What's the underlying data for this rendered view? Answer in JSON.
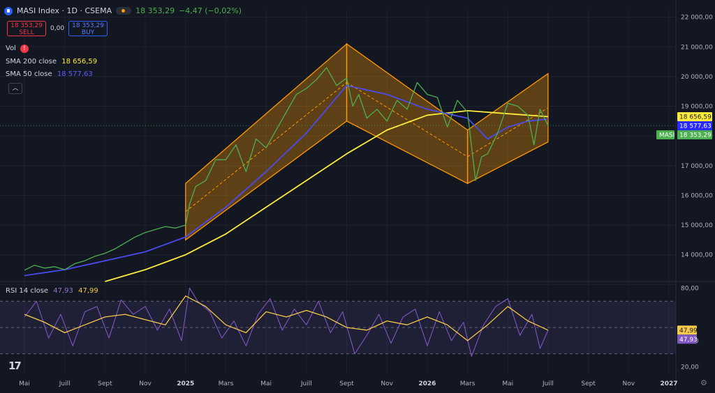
{
  "header": {
    "symbol": "MASI Index · 1D · CSEMA",
    "last": "18 353,29",
    "change": "−4,47 (−0,02%)"
  },
  "trade": {
    "sell_price": "18 353,29",
    "sell_label": "SELL",
    "spread": "0,00",
    "buy_price": "18 353,29",
    "buy_label": "BUY"
  },
  "indicators": {
    "vol": "Vol",
    "sma200_label": "SMA 200 close",
    "sma200_value": "18 656,59",
    "sma50_label": "SMA 50 close",
    "sma50_value": "18 577,63",
    "rsi_label": "RSI 14 close",
    "rsi_value": "47,93",
    "rsi_ma_value": "47,99"
  },
  "logo_text": "17",
  "colors": {
    "price": "#4caf50",
    "sma200": "#ffeb3b",
    "sma50": "#4a4aef",
    "channel": "#ff9800",
    "rsi": "#7e57c2",
    "rsi_ma": "#f7c948",
    "bg": "#131722"
  },
  "chart_data": [
    {
      "type": "line",
      "pane": "price",
      "y_ticks": [
        13000,
        14000,
        15000,
        16000,
        17000,
        18000,
        19000,
        20000,
        21000,
        22000
      ],
      "y_tick_labels": [
        "",
        "14 000,00",
        "15 000,00",
        "16 000,00",
        "17 000,00",
        "18 000,00",
        "19 000,00",
        "20 000,00",
        "21 000,00",
        "22 000,00"
      ],
      "ylim": [
        13100,
        22250
      ],
      "x_tick_labels": [
        "Mai",
        "Juill",
        "Sept",
        "Nov",
        "2025",
        "Mars",
        "Mai",
        "Juill",
        "Sept",
        "Nov",
        "2026",
        "Mars",
        "Mai",
        "Juill",
        "Sept",
        "Nov",
        "2027"
      ],
      "x_tick_index": [
        0,
        2,
        4,
        6,
        8,
        10,
        12,
        14,
        16,
        18,
        20,
        22,
        24,
        26,
        28,
        30,
        32
      ],
      "series": [
        {
          "name": "MASI",
          "x": [
            0,
            0.5,
            1,
            1.5,
            2,
            2.5,
            3,
            3.5,
            4,
            4.5,
            5,
            5.5,
            6,
            6.5,
            7,
            7.5,
            8,
            8.2,
            8.5,
            9,
            9.5,
            10,
            10.5,
            11,
            11.5,
            12,
            12.5,
            13,
            13.5,
            14,
            14.5,
            15,
            15.5,
            16,
            16.3,
            16.6,
            17,
            17.5,
            18,
            18.5,
            19,
            19.5,
            20,
            20.5,
            21,
            21.5,
            22,
            22.4,
            22.7,
            23,
            23.5,
            24,
            24.5,
            25,
            25.3,
            25.6,
            26
          ],
          "y": [
            13480,
            13650,
            13550,
            13600,
            13500,
            13700,
            13800,
            13950,
            14050,
            14200,
            14400,
            14600,
            14750,
            14850,
            14950,
            14900,
            15000,
            15700,
            16300,
            16500,
            17200,
            17200,
            17700,
            16800,
            17900,
            17600,
            18200,
            18800,
            19400,
            19600,
            19900,
            20300,
            19700,
            19950,
            19000,
            19400,
            18600,
            18900,
            18500,
            19200,
            18900,
            19800,
            19400,
            19300,
            18300,
            19200,
            18800,
            16500,
            17300,
            17400,
            18100,
            19100,
            19000,
            18700,
            17700,
            18900,
            18350
          ]
        },
        {
          "name": "SMA 200 close",
          "x": [
            4,
            6,
            8,
            10,
            12,
            14,
            16,
            18,
            20,
            22,
            24,
            26
          ],
          "y": [
            13100,
            13500,
            14000,
            14700,
            15600,
            16500,
            17400,
            18200,
            18700,
            18850,
            18750,
            18650
          ]
        },
        {
          "name": "SMA 50 close",
          "x": [
            0,
            2,
            4,
            6,
            8,
            10,
            12,
            14,
            16,
            18,
            20,
            22,
            23,
            24,
            25,
            26
          ],
          "y": [
            13300,
            13500,
            13800,
            14100,
            14600,
            15600,
            16800,
            18100,
            19700,
            19400,
            18900,
            18600,
            17900,
            18300,
            18500,
            18570
          ]
        }
      ],
      "channels": [
        {
          "x": [
            8,
            16
          ],
          "upper": [
            16400,
            21100
          ],
          "lower": [
            14500,
            18500
          ]
        },
        {
          "x": [
            16,
            22
          ],
          "upper": [
            21100,
            18200
          ],
          "lower": [
            18500,
            16400
          ]
        },
        {
          "x": [
            22,
            26
          ],
          "upper": [
            18200,
            20100
          ],
          "lower": [
            16400,
            17800
          ]
        }
      ],
      "last_value_labels": [
        {
          "series": "SMA 200 close",
          "value": "18 656,59"
        },
        {
          "series": "SMA 50 close",
          "value": "18 577,63"
        },
        {
          "series": "MASI",
          "value": "18 353,29",
          "tag": "MASI"
        }
      ]
    },
    {
      "type": "line",
      "pane": "rsi",
      "ylim": [
        15,
        85
      ],
      "y_ticks": [
        20,
        40,
        60,
        80
      ],
      "y_tick_labels": [
        "20,00",
        "40,00",
        "",
        "80,00"
      ],
      "bands": [
        30,
        50,
        70
      ],
      "series": [
        {
          "name": "RSI 14 close",
          "x": [
            0,
            0.6,
            1.2,
            1.8,
            2.4,
            3,
            3.6,
            4.2,
            4.8,
            5.4,
            6,
            6.6,
            7.2,
            7.8,
            8.2,
            8.6,
            9.2,
            9.8,
            10.4,
            11,
            11.6,
            12.2,
            12.8,
            13.4,
            14,
            14.6,
            15.2,
            15.8,
            16.4,
            17,
            17.6,
            18.2,
            18.8,
            19.4,
            20,
            20.6,
            21.2,
            21.8,
            22.2,
            22.8,
            23.4,
            24,
            24.6,
            25.2,
            25.6,
            26
          ],
          "y": [
            58,
            70,
            42,
            60,
            36,
            62,
            66,
            42,
            71,
            60,
            66,
            48,
            64,
            40,
            80,
            70,
            62,
            42,
            55,
            36,
            60,
            72,
            48,
            64,
            52,
            70,
            46,
            62,
            30,
            44,
            60,
            38,
            58,
            64,
            36,
            62,
            40,
            54,
            28,
            52,
            66,
            72,
            44,
            60,
            34,
            47.93
          ]
        },
        {
          "name": "RSI MA",
          "x": [
            0,
            1,
            2,
            3,
            4,
            5,
            6,
            7,
            8,
            9,
            10,
            11,
            12,
            13,
            14,
            15,
            16,
            17,
            18,
            19,
            20,
            21,
            22,
            23,
            24,
            25,
            26
          ],
          "y": [
            60,
            54,
            46,
            52,
            58,
            60,
            56,
            52,
            74,
            66,
            52,
            46,
            62,
            58,
            63,
            58,
            50,
            48,
            55,
            52,
            58,
            52,
            40,
            52,
            66,
            55,
            47.99
          ]
        }
      ],
      "last_value_labels": [
        {
          "series": "RSI MA",
          "value": "47,99"
        },
        {
          "series": "RSI 14 close",
          "value": "47,93"
        }
      ]
    }
  ]
}
